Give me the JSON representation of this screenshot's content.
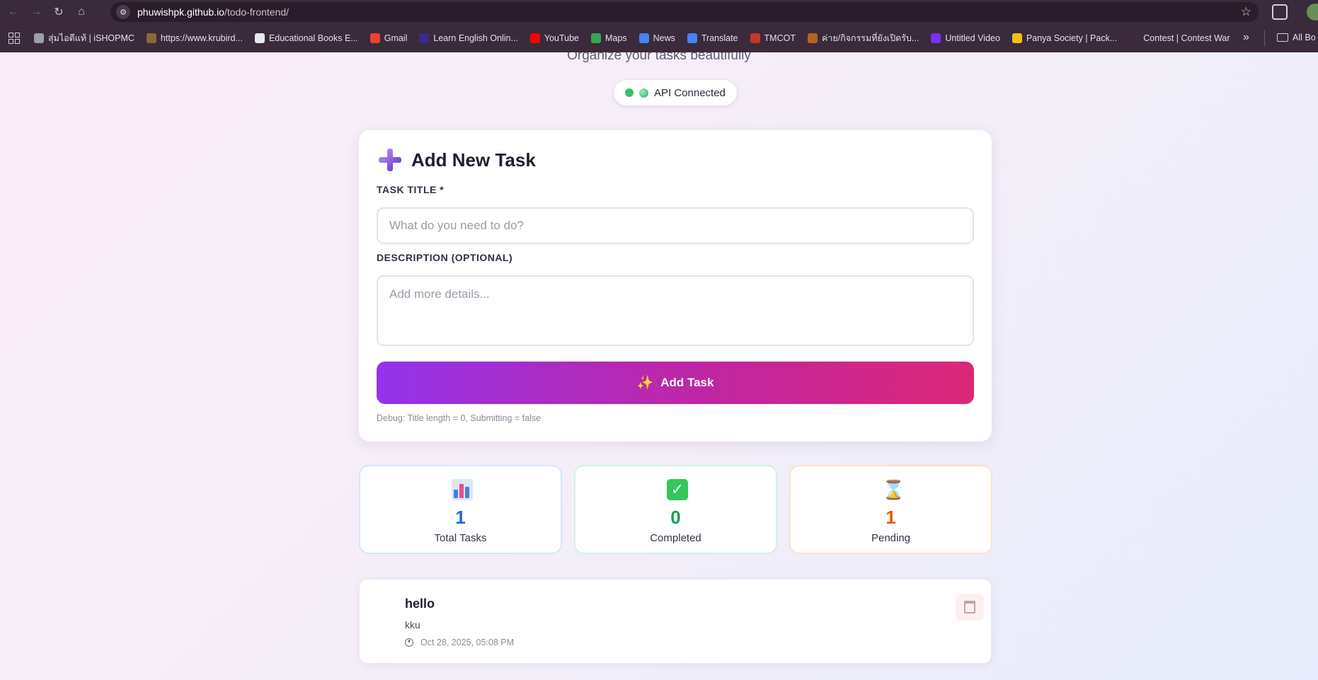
{
  "browser": {
    "url_host": "phuwishpk.github.io",
    "url_path": "/todo-frontend/",
    "bookmarks": [
      {
        "label": "สุ่มไอดีแท้ | iSHOPMC",
        "color": "#9aa0a6"
      },
      {
        "label": "https://www.krubird...",
        "color": "#8a6a3a"
      },
      {
        "label": "Educational Books E...",
        "color": "#e8eaed"
      },
      {
        "label": "Gmail",
        "color": "#ea4335"
      },
      {
        "label": "Learn English Onlin...",
        "color": "#3b2a8a"
      },
      {
        "label": "YouTube",
        "color": "#ff0000"
      },
      {
        "label": "Maps",
        "color": "#34a853"
      },
      {
        "label": "News",
        "color": "#4285f4"
      },
      {
        "label": "Translate",
        "color": "#4285f4"
      },
      {
        "label": "TMCOT",
        "color": "#c0392b"
      },
      {
        "label": "ค่าย/กิจกรรมที่ยังเปิดรับ...",
        "color": "#b5651d"
      },
      {
        "label": "Untitled Video",
        "color": "#7b2ff7"
      },
      {
        "label": "Panya Society | Pack...",
        "color": "#f4c20d"
      },
      {
        "label": "Contest | Contest War",
        "color": "#3a2a3b"
      }
    ],
    "more_label": "»",
    "all_bookmarks_label": "All Bo"
  },
  "header": {
    "subtitle": "Organize your tasks beautifully",
    "api_status": "API Connected"
  },
  "form": {
    "title": "Add New Task",
    "title_label": "TASK TITLE *",
    "title_placeholder": "What do you need to do?",
    "desc_label": "DESCRIPTION (OPTIONAL)",
    "desc_placeholder": "Add more details...",
    "submit_label": "Add Task",
    "debug": "Debug: Title length = 0, Submitting = false"
  },
  "stats": {
    "total": {
      "value": "1",
      "label": "Total Tasks",
      "color": "#2563eb"
    },
    "completed": {
      "value": "0",
      "label": "Completed",
      "color": "#16a34a"
    },
    "pending": {
      "value": "1",
      "label": "Pending",
      "color": "#ea580c"
    }
  },
  "tasks": [
    {
      "title": "hello",
      "description": "kku",
      "date": "Oct 28, 2025, 05:08 PM"
    }
  ]
}
